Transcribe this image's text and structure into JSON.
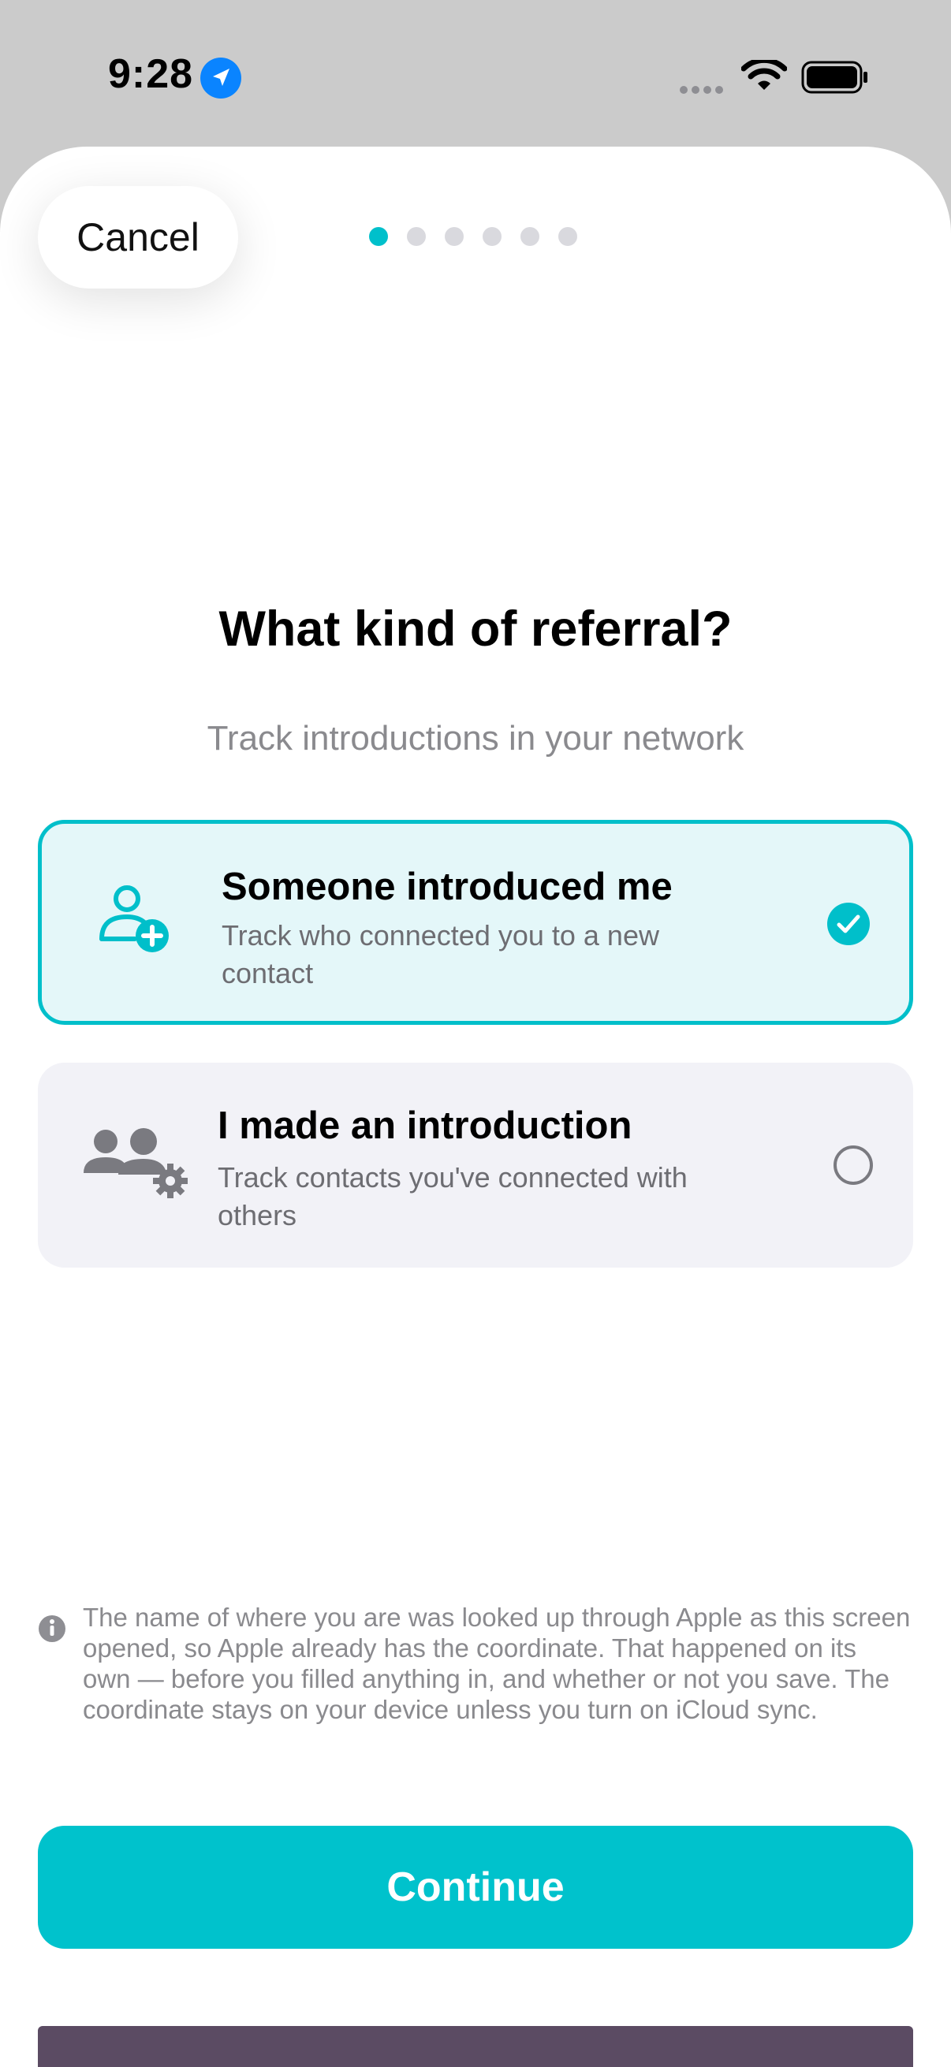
{
  "status_bar": {
    "time": "9:28"
  },
  "sheet": {
    "cancel_label": "Cancel",
    "progress": {
      "total_steps": 6,
      "current_step": 1
    },
    "title": "What kind of referral?",
    "subtitle": "Track introductions in your network",
    "options": [
      {
        "title": "Someone introduced me",
        "description": "Track who connected you to a new contact",
        "icon": "person-add-icon",
        "selected": true
      },
      {
        "title": "I made an introduction",
        "description": "Track contacts you've connected with others",
        "icon": "people-gear-icon",
        "selected": false
      }
    ],
    "privacy_note": "The name of where you are was looked up through Apple as this screen opened, so Apple already has the coordinate. That happened on its own — before you filled anything in, and whether or not you save. The coordinate stays on your device unless you turn on iCloud sync.",
    "continue_label": "Continue"
  },
  "colors": {
    "accent": "#00c2cc",
    "selected_card_bg": "#e4f7f9",
    "unselected_card_bg": "#f2f2f7",
    "secondary_text": "#8a8a8e"
  }
}
